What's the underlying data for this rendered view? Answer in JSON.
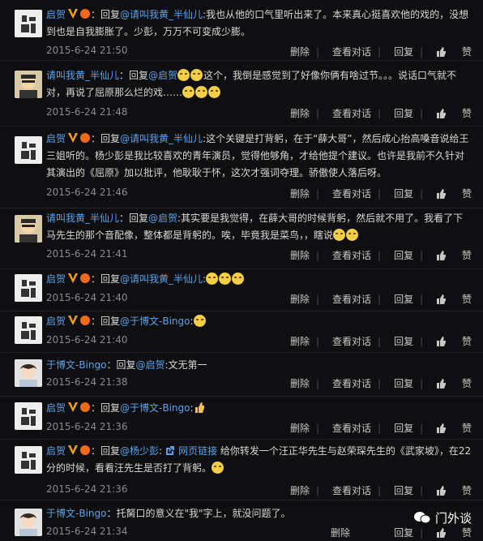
{
  "actions": {
    "delete": "删除",
    "view_conversation": "查看对话",
    "reply": "回复",
    "like": "赞"
  },
  "comments": [
    {
      "user": "启贺",
      "reply_label": "：回复",
      "mention": "@请叫我黄_半仙儿",
      "text": ":我也从他的口气里听出来了。本来真心挺喜欢他的戏的，没想到也是自我膨胀了。少彭，万万不可变成少膨。",
      "time": "2015-6-24 21:50"
    },
    {
      "user": "请叫我黄_半仙儿",
      "reply_label": "：回复",
      "mention": "@启贺",
      "text": "这个，我倒是感觉到了好像你俩有啥过节。。。说话口气就不对，再说了屈原那么烂的戏……",
      "time": "2015-6-24 21:48"
    },
    {
      "user": "启贺",
      "reply_label": "：回复",
      "mention": "@请叫我黄_半仙儿",
      "text": ":这个关键是打背躬，在于“薛大哥”，然后成心抬高嗓音说给王三姐听的。杨少彭是我比较喜欢的青年演员，觉得他够角，才给他提个建议。也许是我前不久针对其演出的《屈原》加以批评，他耿耿于怀，这次才强词夺理。骄傲使人落后呀。",
      "time": "2015-6-24 21:46"
    },
    {
      "user": "请叫我黄_半仙儿",
      "reply_label": "：回复",
      "mention": "@启贺",
      "text": ":其实要是我觉得，在薛大哥的时候背躬，然后就不用了。我看了下马先生的那个音配像，整体都是背躬的。唉，毕竟我是菜鸟，，瞎说",
      "time": "2015-6-24 21:41"
    },
    {
      "user": "启贺",
      "reply_label": "：回复",
      "mention": "@请叫我黄_半仙儿",
      "text": ":",
      "time": "2015-6-24 21:40"
    },
    {
      "user": "启贺",
      "reply_label": "：回复",
      "mention": "@于博文-Bingo",
      "text": ":",
      "time": "2015-6-24 21:40"
    },
    {
      "user": "于博文-Bingo",
      "reply_label": "：回复",
      "mention": "@启贺",
      "text": ":文无第一",
      "time": "2015-6-24 21:38"
    },
    {
      "user": "启贺",
      "reply_label": "：回复",
      "mention": "@于博文-Bingo",
      "text": ":",
      "time": "2015-6-24 21:36"
    },
    {
      "user": "启贺",
      "reply_label": "：回复",
      "mention": "@杨少彭",
      "text_pre": ":",
      "link": "网页链接",
      "text": " 给你转发一个汪正华先生与赵荣琛先生的《武家坡》，在22分的时候，看看汪先生是否打了背躬。",
      "time": "2015-6-24 21:36"
    },
    {
      "user": "于博文-Bingo",
      "reply_label": "：",
      "mention": "",
      "text": "托胬口的意义在\"我\"字上，就没问题了。",
      "time": "2015-6-24 21:34"
    }
  ],
  "watermark": "门外谈"
}
